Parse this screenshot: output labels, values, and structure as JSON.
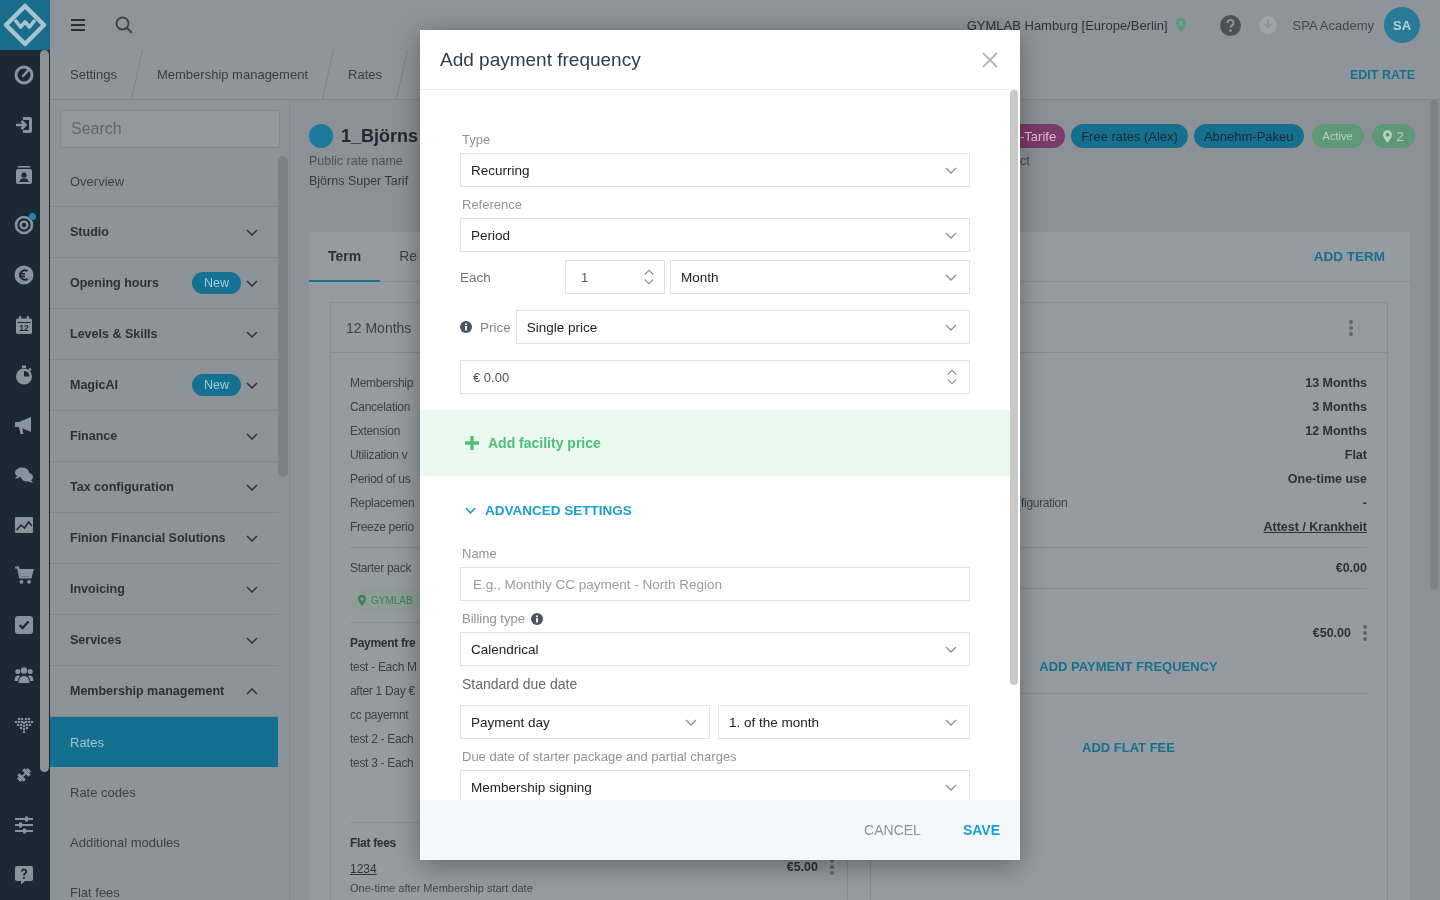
{
  "rail": {
    "items": [
      {
        "notification": false
      },
      {
        "notification": false
      },
      {
        "notification": false
      },
      {
        "notification": true
      },
      {
        "notification": false
      },
      {
        "notification": false,
        "text": "12"
      },
      {
        "notification": false
      },
      {
        "notification": false
      },
      {
        "notification": false
      },
      {
        "notification": false
      },
      {
        "notification": false
      },
      {
        "notification": false
      },
      {
        "notification": false
      },
      {
        "notification": false
      },
      {
        "notification": false
      },
      {
        "notification": false
      },
      {
        "notification": false
      }
    ]
  },
  "topbar": {
    "location": "GYMLAB Hamburg [Europe/Berlin]",
    "user": "SPA Academy",
    "initials": "SA"
  },
  "breadcrumbs": {
    "items": [
      "Settings",
      "Membership management",
      "Rates"
    ],
    "action": "EDIT RATE"
  },
  "settings_nav": {
    "search": {
      "placeholder": "Search"
    },
    "items": [
      {
        "label": "Overview",
        "kind": "page",
        "selected": false
      },
      {
        "label": "Studio",
        "kind": "section",
        "selected": false,
        "expanded": false
      },
      {
        "label": "Opening hours",
        "kind": "section",
        "selected": false,
        "expanded": false,
        "badge": "New"
      },
      {
        "label": "Levels & Skills",
        "kind": "section",
        "selected": false,
        "expanded": false
      },
      {
        "label": "MagicAI",
        "kind": "section",
        "selected": false,
        "expanded": false,
        "badge": "New"
      },
      {
        "label": "Finance",
        "kind": "section",
        "selected": false,
        "expanded": false
      },
      {
        "label": "Tax configuration",
        "kind": "section",
        "selected": false,
        "expanded": false
      },
      {
        "label": "Finion Financial Solutions",
        "kind": "section",
        "selected": false,
        "expanded": false
      },
      {
        "label": "Invoicing",
        "kind": "section",
        "selected": false,
        "expanded": false
      },
      {
        "label": "Services",
        "kind": "section",
        "selected": false,
        "expanded": false
      },
      {
        "label": "Membership management",
        "kind": "section",
        "selected": false,
        "expanded": true,
        "children": [
          {
            "label": "Rates",
            "selected": true
          },
          {
            "label": "Rate codes",
            "selected": false
          },
          {
            "label": "Additional modules",
            "selected": false
          },
          {
            "label": "Flat fees",
            "selected": false
          }
        ]
      }
    ]
  },
  "rate": {
    "name": "1_Björns",
    "public_name_label": "Public rate name",
    "public_name": "Björns Super Tarif",
    "tags": [
      {
        "text": "-Tarife",
        "color": "#7b3a68"
      },
      {
        "text": "Free rates (Alex)",
        "color": "#15708f"
      },
      {
        "text": "Abnehm-Pakeu",
        "color": "#15708f"
      }
    ],
    "status": "Active",
    "locations": "2",
    "text_fragment": "ct",
    "tabs": [
      {
        "label": "Term",
        "selected": true
      },
      {
        "label": "Re",
        "selected": false
      }
    ],
    "add_term": "ADD TERM",
    "terms": [
      {
        "title": "12 Months",
        "menu": false,
        "rows": [
          {
            "label": "Membership"
          },
          {
            "label": "Cancelation"
          },
          {
            "label": "Extension"
          },
          {
            "label": "Utilization v"
          },
          {
            "label": "Period of us"
          },
          {
            "label": "Replacemen"
          },
          {
            "label": "Freeze perio"
          }
        ],
        "starter": {
          "label": "Starter pack",
          "studio": "GYMLAB"
        },
        "payments": {
          "title": "Payment fre",
          "items": [
            {
              "name": "test - Each M"
            },
            {
              "name": "after 1 Day €"
            },
            {
              "name": "cc payemnt"
            },
            {
              "name": "test 2 - Each"
            },
            {
              "name": "test 3 - Each"
            }
          ]
        },
        "flat_fees": {
          "title": "Flat fees",
          "items": [
            {
              "name": "1234",
              "note": "One-time after Membership start date",
              "price": "€5.00"
            }
          ]
        }
      },
      {
        "menu": true,
        "rows": [
          {
            "value": "13 Months",
            "kind": "text"
          },
          {
            "value": "3 Months",
            "kind": "text"
          },
          {
            "value": "12 Months",
            "kind": "text"
          },
          {
            "value": "Flat",
            "kind": "text"
          },
          {
            "value": "One-time use",
            "kind": "text"
          },
          {
            "label": "figuration",
            "value": "-",
            "kind": "text"
          },
          {
            "value": "Attest / Krankheit",
            "kind": "link"
          }
        ],
        "starter": {
          "price": "€0.00"
        },
        "payments": {
          "items": [
            {
              "price": "€50.00"
            }
          ],
          "add": "ADD PAYMENT FREQUENCY"
        },
        "flat_fees": {
          "add": "ADD FLAT FEE"
        }
      }
    ]
  },
  "modal": {
    "title": "Add payment frequency",
    "type": {
      "label": "Type",
      "value": "Recurring"
    },
    "reference": {
      "label": "Reference",
      "value": "Period"
    },
    "interval": {
      "label": "Each",
      "count": "1",
      "unit": "Month"
    },
    "price": {
      "label": "Price",
      "mode": "Single price",
      "amount": "€ 0.00"
    },
    "facility_price": {
      "label": "Add facility price"
    },
    "advanced": {
      "label": "ADVANCED SETTINGS",
      "expanded": true,
      "name": {
        "label": "Name",
        "placeholder": "E.g., Monthly CC payment - North Region"
      },
      "billing_type": {
        "label": "Billing type",
        "value": "Calendrical"
      },
      "standard_due_date": {
        "label": "Standard due date",
        "basis": "Payment day",
        "day": "1. of the month"
      },
      "starter_due_date": {
        "label": "Due date of starter package and partial charges",
        "value": "Membership signing"
      }
    },
    "buttons": [
      {
        "label": "CANCEL",
        "kind": "secondary"
      },
      {
        "label": "SAVE",
        "kind": "primary"
      }
    ]
  }
}
